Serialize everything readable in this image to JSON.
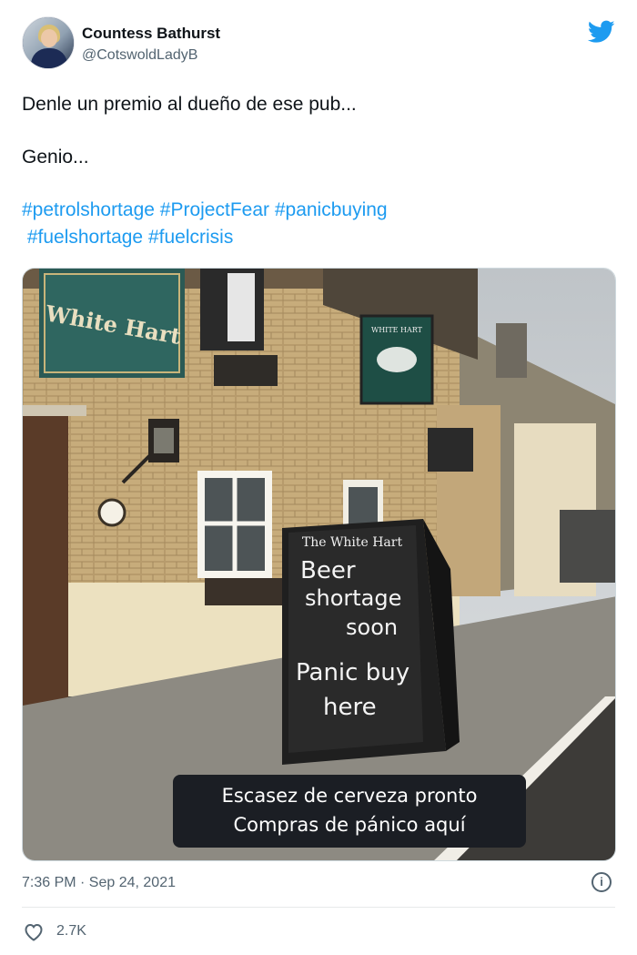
{
  "tweet": {
    "author_name": "Countess Bathurst",
    "author_handle": "@CotswoldLadyB",
    "text_line1": "Denle un premio al dueño de ese pub...",
    "text_line2": "Genio...",
    "hashtags_line1": [
      "#petrolshortage",
      "#ProjectFear",
      "#panicbuying"
    ],
    "hashtags_line2": [
      "#fuelshortage",
      "#fuelcrisis"
    ],
    "timestamp": "7:36 PM · Sep 24, 2021",
    "like_count": "2.7K"
  },
  "image": {
    "pub_sign_main": "White Hart",
    "pub_sign_hanging": "WHITE HART",
    "chalkboard_header": "The White Hart",
    "chalkboard_lines": [
      "Beer",
      "shortage",
      "soon",
      "Panic buy",
      "here"
    ],
    "caption_line1": "Escasez de cerveza pronto",
    "caption_line2": "Compras de pánico aquí"
  },
  "icons": {
    "brand": "twitter-bird-icon",
    "info": "info-icon",
    "like": "heart-icon"
  },
  "colors": {
    "link": "#1d9bf0",
    "twitter_blue": "#1d9bf0",
    "muted": "#536471"
  }
}
